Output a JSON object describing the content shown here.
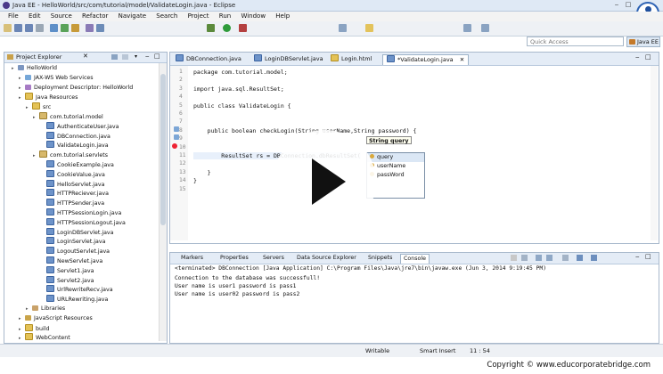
{
  "window": {
    "title": "Java EE - HelloWorld/src/com/tutorial/model/ValidateLogin.java - Eclipse"
  },
  "menu": [
    "File",
    "Edit",
    "Source",
    "Refactor",
    "Navigate",
    "Search",
    "Project",
    "Run",
    "Window",
    "Help"
  ],
  "quick_access": {
    "placeholder": "Quick Access"
  },
  "perspective": "Java EE",
  "project_explorer": {
    "title": "Project Explorer",
    "items": [
      {
        "label": "HelloWorld",
        "icon": "project-icon"
      },
      {
        "label": "JAX-WS Web Services",
        "icon": "webservice-icon"
      },
      {
        "label": "Deployment Descriptor: HelloWorld",
        "icon": "descriptor-icon"
      },
      {
        "label": "Java Resources",
        "icon": "folder-icon"
      },
      {
        "label": "src",
        "icon": "folder-icon"
      },
      {
        "label": "com.tutorial.model",
        "icon": "package-icon"
      },
      {
        "label": "AuthenticateUser.java",
        "icon": "java-file-icon"
      },
      {
        "label": "DBConnection.java",
        "icon": "java-file-icon"
      },
      {
        "label": "ValidateLogin.java",
        "icon": "java-file-icon"
      },
      {
        "label": "com.tutorial.servlets",
        "icon": "package-icon"
      },
      {
        "label": "CookieExample.java",
        "icon": "java-file-icon"
      },
      {
        "label": "CookieValue.java",
        "icon": "java-file-icon"
      },
      {
        "label": "HelloServlet.java",
        "icon": "java-file-icon"
      },
      {
        "label": "HTTPReciever.java",
        "icon": "java-file-icon"
      },
      {
        "label": "HTTPSender.java",
        "icon": "java-file-icon"
      },
      {
        "label": "HTTPSessionLogin.java",
        "icon": "java-file-icon"
      },
      {
        "label": "HTTPSessionLogout.java",
        "icon": "java-file-icon"
      },
      {
        "label": "LoginDBServlet.java",
        "icon": "java-file-icon"
      },
      {
        "label": "LoginServlet.java",
        "icon": "java-file-icon"
      },
      {
        "label": "LogoutServlet.java",
        "icon": "java-file-icon"
      },
      {
        "label": "NewServlet.java",
        "icon": "java-file-icon"
      },
      {
        "label": "Servlet1.java",
        "icon": "java-file-icon"
      },
      {
        "label": "Servlet2.java",
        "icon": "java-file-icon"
      },
      {
        "label": "UrlRewriteRecv.java",
        "icon": "java-file-icon"
      },
      {
        "label": "URLRewriting.java",
        "icon": "java-file-icon"
      },
      {
        "label": "Libraries",
        "icon": "library-icon"
      },
      {
        "label": "JavaScript Resources",
        "icon": "javascript-icon"
      },
      {
        "label": "build",
        "icon": "folder-icon"
      },
      {
        "label": "WebContent",
        "icon": "folder-icon"
      }
    ]
  },
  "editor": {
    "tabs": [
      "DBConnection.java",
      "LoginDBServlet.java",
      "Login.html",
      "*ValidateLogin.java"
    ],
    "lines": [
      {
        "n": "1",
        "text": "package com.tutorial.model;"
      },
      {
        "n": "2",
        "text": ""
      },
      {
        "n": "3",
        "text": "import java.sql.ResultSet;"
      },
      {
        "n": "4",
        "text": ""
      },
      {
        "n": "5",
        "text": "public class ValidateLogin {"
      },
      {
        "n": "6",
        "text": ""
      },
      {
        "n": "7",
        "text": ""
      },
      {
        "n": "8",
        "text": "    public boolean checkLogin(String userName,String password) {"
      },
      {
        "n": "9",
        "text": ""
      },
      {
        "n": "10",
        "text": ""
      },
      {
        "n": "11",
        "text": "        ResultSet rs = DBConnection.dbResultSet("
      },
      {
        "n": "12",
        "text": ""
      },
      {
        "n": "13",
        "text": "    }"
      },
      {
        "n": "14",
        "text": "}"
      },
      {
        "n": "15",
        "text": ""
      }
    ],
    "tooltip": "String query",
    "assist_items": [
      "query",
      "userName",
      "passWord"
    ]
  },
  "console": {
    "tabs": [
      "Markers",
      "Properties",
      "Servers",
      "Data Source Explorer",
      "Snippets",
      "Console"
    ],
    "terminated": "<terminated> DBConnection [Java Application] C:\\Program Files\\Java\\jre7\\bin\\javaw.exe (Jun 3, 2014 9:19:45 PM)",
    "output": [
      "Connection to the database was successfull!",
      "User name is user1 password is pass1",
      "User name is user02 password is pass2"
    ]
  },
  "status": {
    "writable": "Writable",
    "insert_mode": "Smart Insert",
    "position": "11 : 54"
  },
  "copyright": "Copyright © www.educorporatebridge.com"
}
